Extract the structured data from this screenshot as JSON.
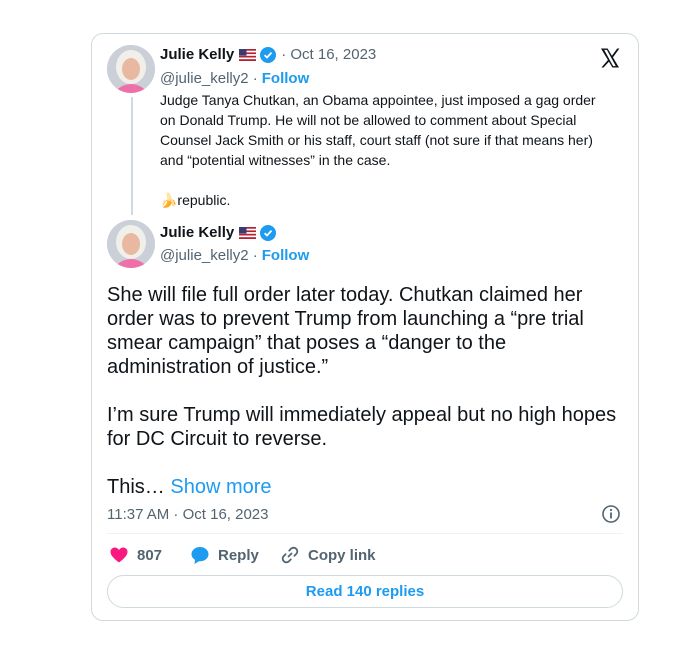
{
  "colors": {
    "accent": "#1d9bf0",
    "like": "#f91880",
    "text": "#0f1419",
    "muted": "#536471",
    "border": "#cfd9de"
  },
  "quoted_tweet": {
    "author_name": "Julie Kelly",
    "flag_icon": "us-flag-icon",
    "verified_icon": "verified-badge-icon",
    "date": "· Oct 16, 2023",
    "handle": "@julie_kelly2 ·",
    "follow_label": "Follow",
    "text": "Judge Tanya Chutkan, an Obama appointee, just imposed a gag order\non Donald Trump. He will not be allowed to comment about Special\nCounsel Jack Smith or his staff, court staff (not sure if that means her)\nand “potential witnesses” in the case.\n\n🍌republic."
  },
  "main_tweet": {
    "author_name": "Julie Kelly",
    "handle": "@julie_kelly2 ·",
    "follow_label": "Follow",
    "text": "She will file full order later today. Chutkan claimed her\norder was to prevent Trump from launching a “pre trial\nsmear campaign” that poses a “danger to the\nadministration of justice.”\n\nI’m sure Trump will immediately appeal but no high hopes\nfor DC Circuit to reverse.",
    "truncated_text": "This…",
    "show_more_label": "Show more",
    "timestamp": "11:37 AM · Oct 16, 2023"
  },
  "actions": {
    "like_count": "807",
    "reply_label": "Reply",
    "copy_link_label": "Copy link"
  },
  "read_replies_label": "Read 140 replies"
}
